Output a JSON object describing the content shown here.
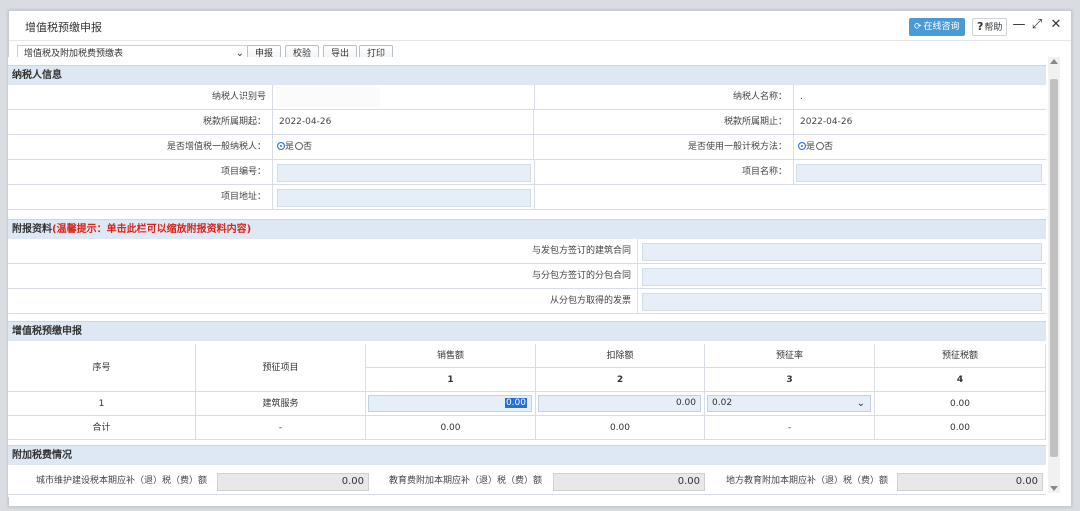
{
  "window": {
    "title": "增值税预缴申报",
    "online_consult": "在线咨询",
    "help": "帮助",
    "help_q": "?",
    "minimize": "—",
    "maximize": "⤢",
    "close": "✕"
  },
  "toolbar": {
    "table_select": "增值税及附加税费预缴表",
    "buttons": [
      "申报",
      "校验",
      "导出",
      "打印"
    ]
  },
  "taxpayer": {
    "header": "纳税人信息",
    "taxpayer_id_label": "纳税人识别号",
    "taxpayer_name_label": "纳税人名称：",
    "taxpayer_name_value": ".",
    "period_start_label": "税款所属期起：",
    "period_start_value": "2022-04-26",
    "period_end_label": "税款所属期止：",
    "period_end_value": "2022-04-26",
    "general_taxpayer_label": "是否增值税一般纳税人：",
    "general_method_label": "是否使用一般计税方法：",
    "yes": "是",
    "no": "否",
    "project_no_label": "项目编号：",
    "project_name_label": "项目名称：",
    "project_addr_label": "项目地址："
  },
  "attachments": {
    "header": "附报资料",
    "tip": "(温馨提示：单击此栏可以缩放附报资料内容)",
    "items": [
      "与发包方签订的建筑合同",
      "与分包方签订的分包合同",
      "从分包方取得的发票"
    ]
  },
  "vat": {
    "header": "增值税预缴申报",
    "columns": [
      "序号",
      "预征项目",
      "销售额",
      "扣除额",
      "预征率",
      "预征税额"
    ],
    "col_numbers": [
      "1",
      "2",
      "3",
      "4"
    ],
    "row": {
      "seq": "1",
      "item": "建筑服务",
      "sales": "0.00",
      "deduction": "0.00",
      "rate": "0.02",
      "tax": "0.00"
    },
    "total": {
      "label": "合计",
      "item": "-",
      "sales": "0.00",
      "deduction": "0.00",
      "rate": "-",
      "tax": "0.00"
    }
  },
  "surcharge": {
    "header": "附加税费情况",
    "urban_label": "城市维护建设税本期应补（退）税（费）额",
    "urban_value": "0.00",
    "edu_label": "教育费附加本期应补（退）税（费）额",
    "edu_value": "0.00",
    "local_edu_label": "地方教育附加本期应补（退）税（费）额",
    "local_edu_value": "0.00"
  },
  "colors": {
    "section_bg": "#dde8f4",
    "input_bg": "#e6eef7",
    "accent": "#4a9ad8",
    "tip_red": "#d9261c"
  }
}
